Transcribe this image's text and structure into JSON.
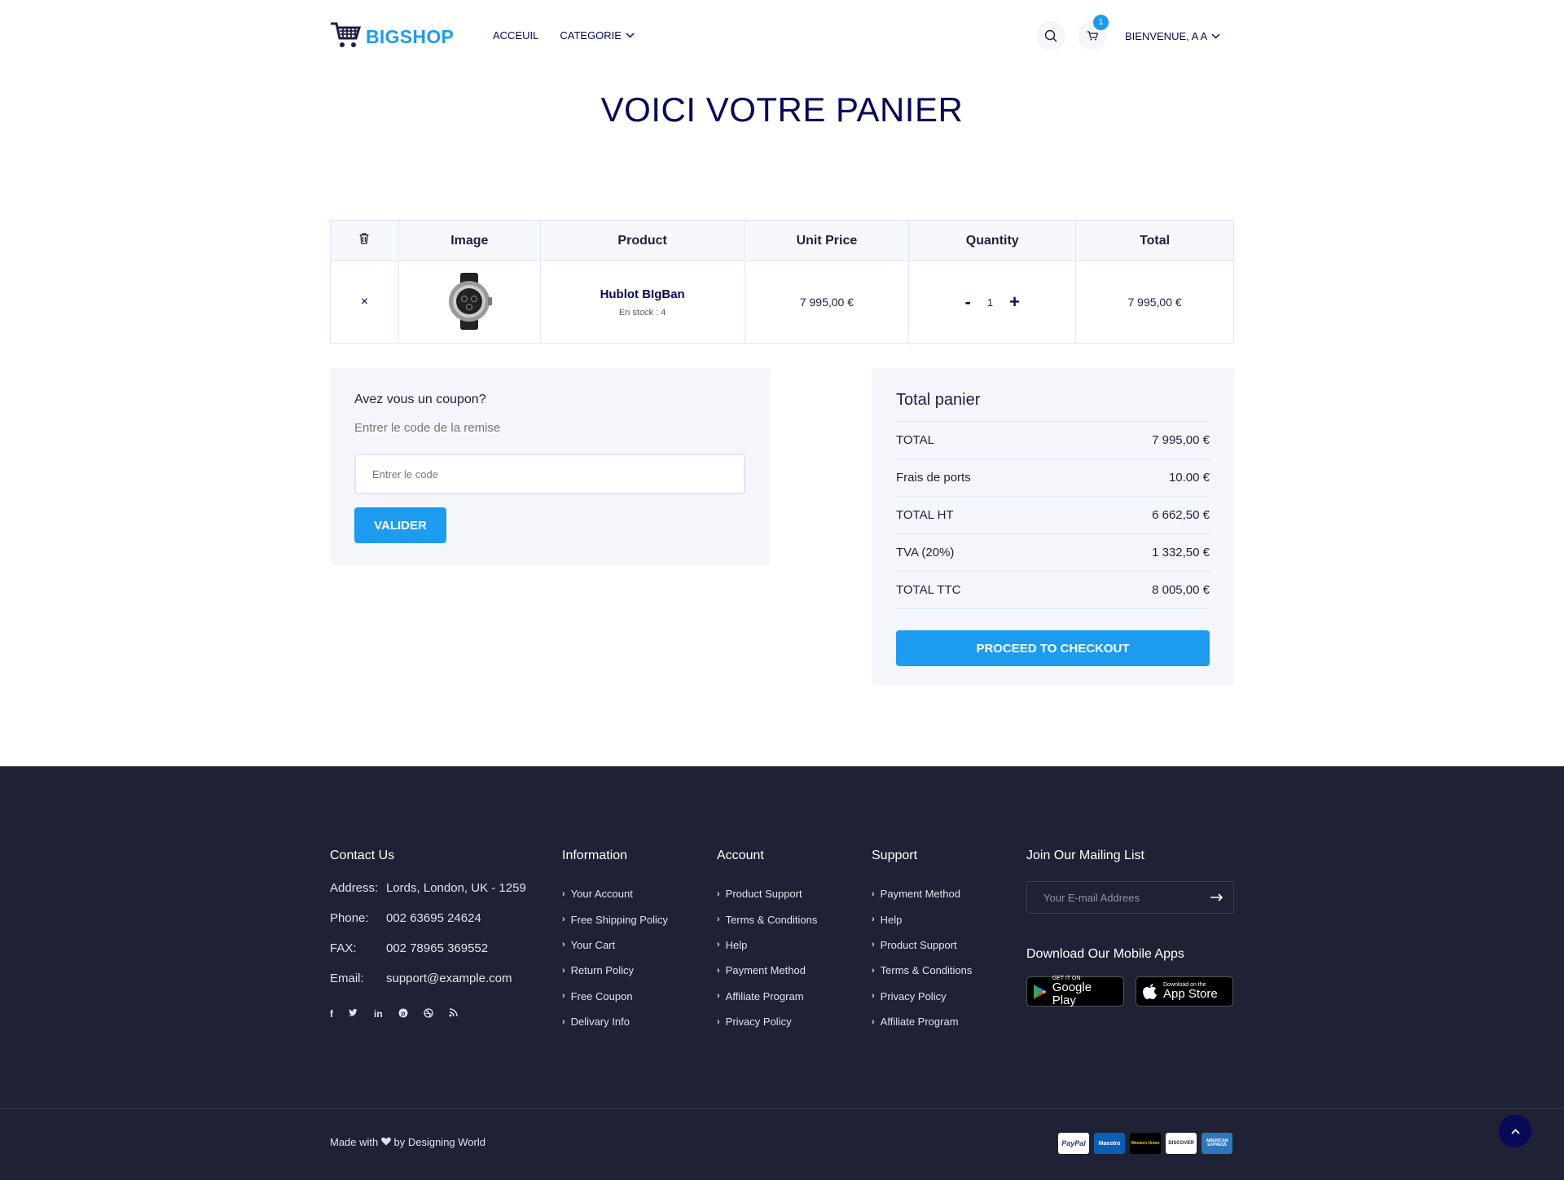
{
  "header": {
    "logo_text": "BIGSHOP",
    "nav": {
      "home": "ACCEUIL",
      "category": "CATEGORIE"
    },
    "cart_count": "1",
    "welcome": "BIENVENUE, A A"
  },
  "page_title": "VOICI VOTRE PANIER",
  "cart_table": {
    "headers": {
      "image": "Image",
      "product": "Product",
      "unit_price": "Unit Price",
      "quantity": "Quantity",
      "total": "Total"
    },
    "rows": [
      {
        "remove": "×",
        "name": "Hublot BIgBan",
        "stock": "En stock : 4",
        "unit_price": "7 995,00 €",
        "qty_minus": "-",
        "quantity": "1",
        "qty_plus": "+",
        "total": "7 995,00 €"
      }
    ]
  },
  "coupon": {
    "title": "Avez vous un coupon?",
    "subtitle": "Entrer le code de la remise",
    "placeholder": "Entrer le code",
    "button": "VALIDER"
  },
  "totals": {
    "title": "Total panier",
    "rows": [
      {
        "label": "TOTAL",
        "value": "7 995,00 €"
      },
      {
        "label": "Frais de ports",
        "value": "10.00 €"
      },
      {
        "label": "TOTAL HT",
        "value": "6 662,50 €"
      },
      {
        "label": "TVA (20%)",
        "value": "1 332,50 €"
      },
      {
        "label": "TOTAL TTC",
        "value": "8 005,00 €"
      }
    ],
    "checkout_button": "PROCEED TO CHECKOUT"
  },
  "footer": {
    "contact": {
      "title": "Contact Us",
      "rows": [
        {
          "k": "Address:",
          "v": "Lords, London, UK - 1259"
        },
        {
          "k": "Phone:",
          "v": "002 63695 24624"
        },
        {
          "k": "FAX:",
          "v": "002 78965 369552"
        },
        {
          "k": "Email:",
          "v": "support@example.com"
        }
      ]
    },
    "information": {
      "title": "Information",
      "links": [
        "Your Account",
        "Free Shipping Policy",
        "Your Cart",
        "Return Policy",
        "Free Coupon",
        "Delivary Info"
      ]
    },
    "account": {
      "title": "Account",
      "links": [
        "Product Support",
        "Terms & Conditions",
        "Help",
        "Payment Method",
        "Affiliate Program",
        "Privacy Policy"
      ]
    },
    "support": {
      "title": "Support",
      "links": [
        "Payment Method",
        "Help",
        "Product Support",
        "Terms & Conditions",
        "Privacy Policy",
        "Affiliate Program"
      ]
    },
    "mailing": {
      "title": "Join Our Mailing List",
      "placeholder": "Your E-mail Addrees"
    },
    "apps": {
      "title": "Download Our Mobile Apps",
      "google_small": "GET IT ON",
      "google_big": "Google Play",
      "apple_small": "Download on the",
      "apple_big": "App Store"
    },
    "made_with": "Made with",
    "made_by": "by Designing World",
    "payments": [
      "PayPal",
      "Maestro",
      "Western Union",
      "DISCOVER",
      "AMERICAN EXPRESS"
    ]
  },
  "colors": {
    "accent": "#1c9bef",
    "navy": "#070a57",
    "footer_bg": "#1f2235",
    "panel_bg": "#f5f6fb"
  },
  "icons": [
    "cart-icon",
    "chevron-down-icon",
    "search-icon",
    "trash-icon",
    "close-icon",
    "watch-image",
    "arrow-right-icon",
    "heart-icon",
    "facebook-icon",
    "twitter-icon",
    "linkedin-icon",
    "pinterest-icon",
    "dribbble-icon",
    "rss-icon",
    "arrow-up-icon"
  ]
}
